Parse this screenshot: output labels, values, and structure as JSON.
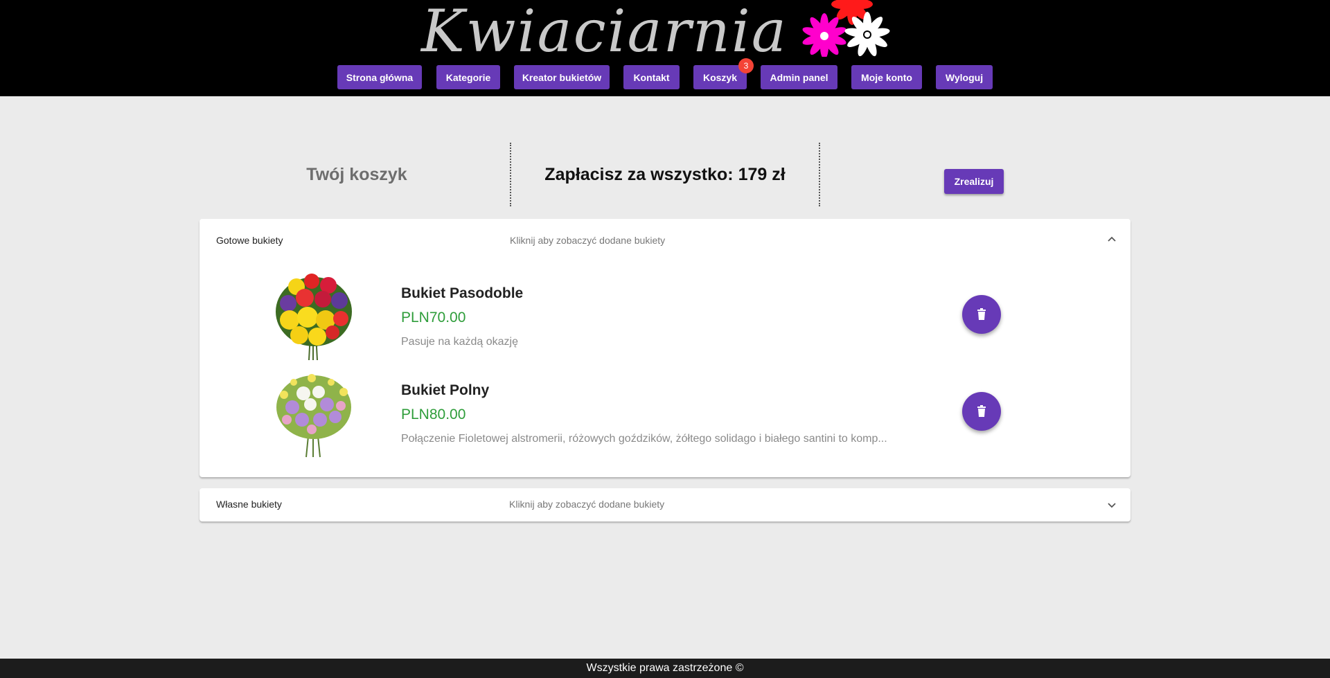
{
  "header": {
    "logo": "Kwiaciarnia",
    "nav": [
      {
        "label": "Strona główna"
      },
      {
        "label": "Kategorie"
      },
      {
        "label": "Kreator bukietów"
      },
      {
        "label": "Kontakt"
      },
      {
        "label": "Koszyk",
        "badge": "3"
      },
      {
        "label": "Admin panel"
      },
      {
        "label": "Moje konto"
      },
      {
        "label": "Wyloguj"
      }
    ]
  },
  "summary": {
    "title": "Twój koszyk",
    "total": "Zapłacisz za wszystko: 179 zł",
    "realize_label": "Zrealizuj"
  },
  "panels": [
    {
      "title": "Gotowe bukiety",
      "description": "Kliknij aby zobaczyć dodane bukiety",
      "expanded": true,
      "items": [
        {
          "name": "Bukiet Pasodoble",
          "price": "PLN70.00",
          "description": "Pasuje na każdą okazję",
          "icon": "trash-icon"
        },
        {
          "name": "Bukiet Polny",
          "price": "PLN80.00",
          "description": "Połączenie Fioletowej alstromerii, różowych goździków, żółtego solidago i białego santini to komp...",
          "icon": "trash-icon"
        }
      ]
    },
    {
      "title": "Własne bukiety",
      "description": "Kliknij aby zobaczyć dodane bukiety",
      "expanded": false
    }
  ],
  "footer": {
    "text": "Wszystkie prawa zastrzeżone ©"
  },
  "colors": {
    "accent": "#673ab7",
    "price": "#2e9d3a",
    "badge": "#f44336",
    "header_bg": "#000000"
  }
}
